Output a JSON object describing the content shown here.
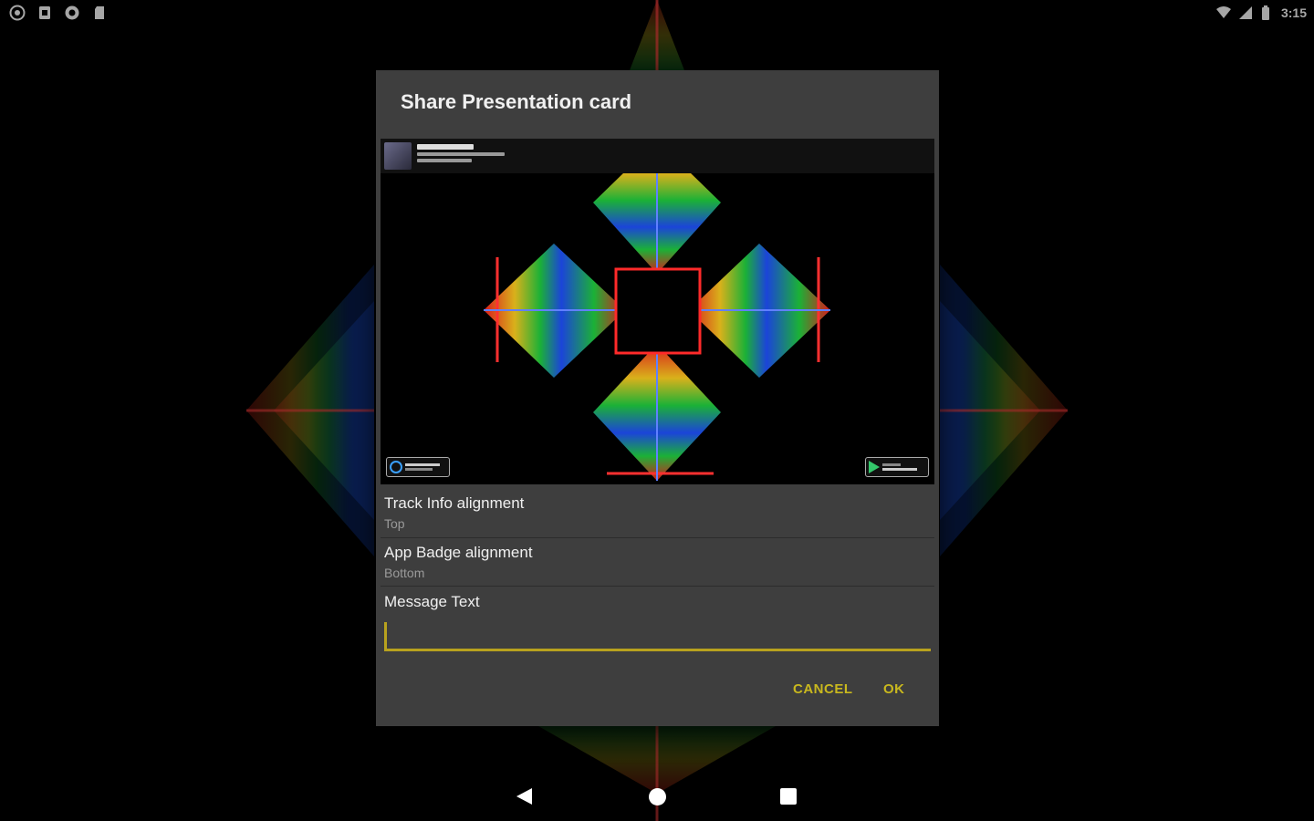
{
  "status_bar": {
    "time": "3:15",
    "left_icons": [
      "music-notification-icon",
      "screenshot-icon",
      "sync-icon",
      "sd-card-icon"
    ],
    "right_icons": [
      "wifi-icon",
      "signal-icon",
      "battery-icon"
    ]
  },
  "dialog": {
    "title": "Share Presentation card",
    "preferences": [
      {
        "title": "Track Info alignment",
        "summary": "Top"
      },
      {
        "title": "App Badge alignment",
        "summary": "Bottom"
      }
    ],
    "message": {
      "label": "Message Text",
      "value": "",
      "placeholder": ""
    },
    "buttons": {
      "cancel": "CANCEL",
      "ok": "OK"
    }
  },
  "preview": {
    "badges": [
      "app-badge",
      "google-play-badge"
    ]
  },
  "nav_bar": {
    "buttons": [
      "back-icon",
      "home-icon",
      "recents-icon"
    ]
  },
  "colors": {
    "accent": "#c9b81e",
    "dialog_bg": "#3e3e3e",
    "summary_text": "#9a9a9a"
  }
}
